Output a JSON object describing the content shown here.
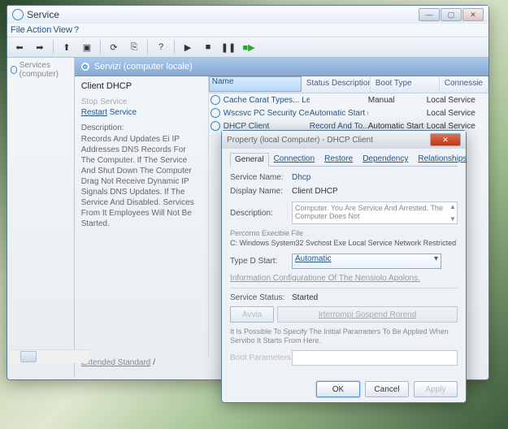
{
  "main": {
    "title": "Service",
    "menu": {
      "file": "File",
      "action": "Action",
      "view": "View",
      "help": "?"
    },
    "tree_root": "Services (computer)",
    "loc": "Servizi (computer locale)",
    "detail": {
      "name": "Client DHCP",
      "stop": "Stop Service",
      "restart": "Restart Service",
      "desc_head": "Description:",
      "desc": "Records And Updates Ei IP Addresses DNS Records For The Computer. If The Service And Shut Down The Computer Drag Not Receive Dynamic IP Signals DNS Updates. If The Service And Disabled. Services From It Employees Will Not Be Started."
    },
    "cols": {
      "name": "Name",
      "status": "Status Description",
      "boot": "Boot Type",
      "conn": "Connessie"
    },
    "rows": [
      {
        "n": "Cache Carat Types... Lets... -",
        "s": "",
        "b": "Manual",
        "c": "Local Service"
      },
      {
        "n": "Wscsvc PC Security Center (C...",
        "s": "Automatic Start (...",
        "b": "",
        "c": "Local Service"
      },
      {
        "n": "DHCP Client",
        "s": "Record And To...",
        "b": "Automatic Start",
        "c": "Local Service"
      }
    ],
    "bottom_tabs": "Extended Standard"
  },
  "dlg": {
    "title": "Property (local Computer) - DHCP Client",
    "tabs": {
      "general": "General",
      "conn": "Connection",
      "restore": "Restore",
      "dep": "Dependency",
      "rel": "Relationships"
    },
    "svc_name_lab": "Service Name:",
    "svc_name": "Dhcp",
    "disp_name_lab": "Display Name:",
    "disp_name": "Client DHCP",
    "desc_lab": "Description:",
    "desc": "Computer. You Are Service And Arrested. The Computer Does Not",
    "path_lab": "Percorno Execible File",
    "path": "C: Windows System32 Svchost Exe Local Service Network Restricted",
    "type_lab": "Type D Start:",
    "type_val": "Automatic",
    "info": "Information Configuratione Of The Nensiolo Apolons.",
    "status_lab": "Service Status:",
    "status_val": "Started",
    "btn_avvia": "Avvia",
    "btn_wide": "Irterrompi Sospend Rorend",
    "note": "It Is Possible To Specify The Initial Parameters To Be Applied When Servibo It Starts From Here.",
    "boot_lab": "Boot Parameters",
    "ok": "OK",
    "cancel": "Cancel",
    "apply": "Apply"
  }
}
